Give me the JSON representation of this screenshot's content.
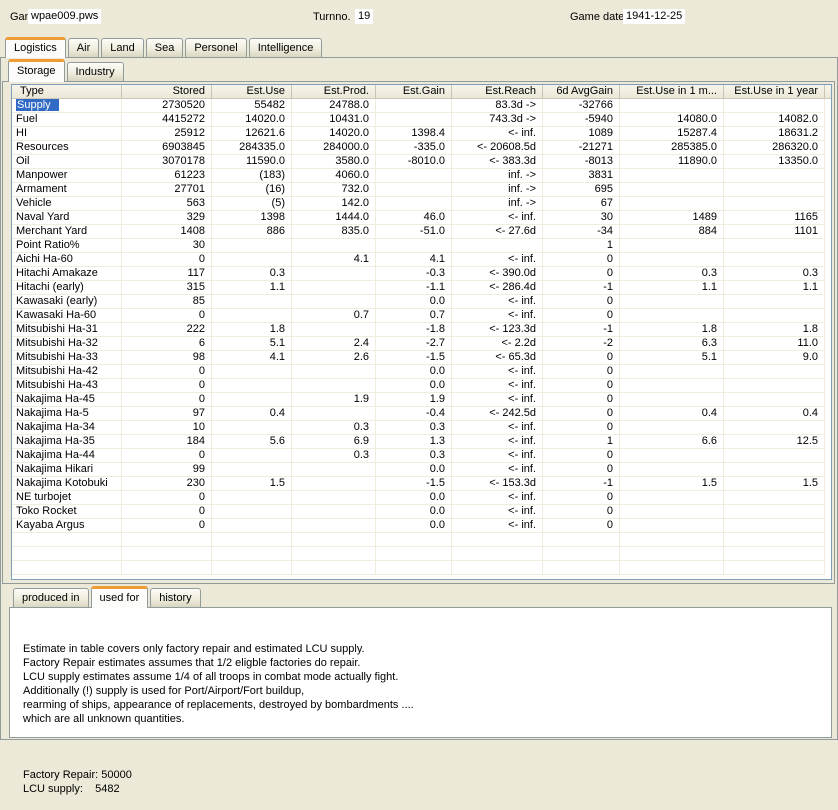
{
  "colors": {
    "window_bg": "#ece9d8",
    "panel_border": "#919b9c",
    "table_border": "#7f9db9",
    "tab_accent": "#ee9c33",
    "selection_blue": "#316ac5"
  },
  "topbar": {
    "game_label": "Game",
    "game_value": "wpae009.pws",
    "turn_label": "Turnno.",
    "turn_value": "19",
    "date_label": "Game date",
    "date_value": "1941-12-25"
  },
  "main_tabs": {
    "items": [
      {
        "label": "Logistics",
        "active": true
      },
      {
        "label": "Air",
        "active": false
      },
      {
        "label": "Land",
        "active": false
      },
      {
        "label": "Sea",
        "active": false
      },
      {
        "label": "Personel",
        "active": false
      },
      {
        "label": "Intelligence",
        "active": false
      }
    ]
  },
  "sub_tabs": {
    "items": [
      {
        "label": "Storage",
        "active": true
      },
      {
        "label": "Industry",
        "active": false
      }
    ]
  },
  "table": {
    "columns": [
      "Type",
      "Stored",
      "Est.Use",
      "Est.Prod.",
      "Est.Gain",
      "Est.Reach",
      "6d AvgGain",
      "Est.Use in 1 m...",
      "Est.Use in 1 year"
    ],
    "selected_cell": {
      "row": 0,
      "col": 0
    },
    "empty_rows": 3,
    "rows": [
      [
        "Supply",
        "2730520",
        "55482",
        "24788.0",
        "",
        "83.3d ->",
        "-32766",
        "",
        ""
      ],
      [
        "Fuel",
        "4415272",
        "14020.0",
        "10431.0",
        "",
        "743.3d ->",
        "-5940",
        "14080.0",
        "14082.0"
      ],
      [
        "HI",
        "25912",
        "12621.6",
        "14020.0",
        "1398.4",
        "<- inf.",
        "1089",
        "15287.4",
        "18631.2"
      ],
      [
        "Resources",
        "6903845",
        "284335.0",
        "284000.0",
        "-335.0",
        "<- 20608.5d",
        "-21271",
        "285385.0",
        "286320.0"
      ],
      [
        "Oil",
        "3070178",
        "11590.0",
        "3580.0",
        "-8010.0",
        "<- 383.3d",
        "-8013",
        "11890.0",
        "13350.0"
      ],
      [
        "Manpower",
        "61223",
        "(183)",
        "4060.0",
        "",
        "inf. ->",
        "3831",
        "",
        ""
      ],
      [
        "Armament",
        "27701",
        "(16)",
        "732.0",
        "",
        "inf. ->",
        "695",
        "",
        ""
      ],
      [
        "Vehicle",
        "563",
        "(5)",
        "142.0",
        "",
        "inf. ->",
        "67",
        "",
        ""
      ],
      [
        "Naval Yard",
        "329",
        "1398",
        "1444.0",
        "46.0",
        "<- inf.",
        "30",
        "1489",
        "1165"
      ],
      [
        "Merchant Yard",
        "1408",
        "886",
        "835.0",
        "-51.0",
        "<- 27.6d",
        "-34",
        "884",
        "1101"
      ],
      [
        "Point Ratio%",
        "30",
        "",
        "",
        "",
        "",
        "1",
        "",
        ""
      ],
      [
        "Aichi Ha-60",
        "0",
        "",
        "4.1",
        "4.1",
        "<- inf.",
        "0",
        "",
        ""
      ],
      [
        "Hitachi Amakaze",
        "117",
        "0.3",
        "",
        "-0.3",
        "<- 390.0d",
        "0",
        "0.3",
        "0.3"
      ],
      [
        "Hitachi (early)",
        "315",
        "1.1",
        "",
        "-1.1",
        "<- 286.4d",
        "-1",
        "1.1",
        "1.1"
      ],
      [
        "Kawasaki (early)",
        "85",
        "",
        "",
        "0.0",
        "<- inf.",
        "0",
        "",
        ""
      ],
      [
        "Kawasaki Ha-60",
        "0",
        "",
        "0.7",
        "0.7",
        "<- inf.",
        "0",
        "",
        ""
      ],
      [
        "Mitsubishi Ha-31",
        "222",
        "1.8",
        "",
        "-1.8",
        "<- 123.3d",
        "-1",
        "1.8",
        "1.8"
      ],
      [
        "Mitsubishi Ha-32",
        "6",
        "5.1",
        "2.4",
        "-2.7",
        "<- 2.2d",
        "-2",
        "6.3",
        "11.0"
      ],
      [
        "Mitsubishi Ha-33",
        "98",
        "4.1",
        "2.6",
        "-1.5",
        "<- 65.3d",
        "0",
        "5.1",
        "9.0"
      ],
      [
        "Mitsubishi Ha-42",
        "0",
        "",
        "",
        "0.0",
        "<- inf.",
        "0",
        "",
        ""
      ],
      [
        "Mitsubishi Ha-43",
        "0",
        "",
        "",
        "0.0",
        "<- inf.",
        "0",
        "",
        ""
      ],
      [
        "Nakajima Ha-45",
        "0",
        "",
        "1.9",
        "1.9",
        "<- inf.",
        "0",
        "",
        ""
      ],
      [
        "Nakajima Ha-5",
        "97",
        "0.4",
        "",
        "-0.4",
        "<- 242.5d",
        "0",
        "0.4",
        "0.4"
      ],
      [
        "Nakajima Ha-34",
        "10",
        "",
        "0.3",
        "0.3",
        "<- inf.",
        "0",
        "",
        ""
      ],
      [
        "Nakajima Ha-35",
        "184",
        "5.6",
        "6.9",
        "1.3",
        "<- inf.",
        "1",
        "6.6",
        "12.5"
      ],
      [
        "Nakajima Ha-44",
        "0",
        "",
        "0.3",
        "0.3",
        "<- inf.",
        "0",
        "",
        ""
      ],
      [
        "Nakajima Hikari",
        "99",
        "",
        "",
        "0.0",
        "<- inf.",
        "0",
        "",
        ""
      ],
      [
        "Nakajima Kotobuki",
        "230",
        "1.5",
        "",
        "-1.5",
        "<- 153.3d",
        "-1",
        "1.5",
        "1.5"
      ],
      [
        "NE turbojet",
        "0",
        "",
        "",
        "0.0",
        "<- inf.",
        "0",
        "",
        ""
      ],
      [
        "Toko Rocket",
        "0",
        "",
        "",
        "0.0",
        "<- inf.",
        "0",
        "",
        ""
      ],
      [
        "Kayaba Argus",
        "0",
        "",
        "",
        "0.0",
        "<- inf.",
        "0",
        "",
        ""
      ]
    ]
  },
  "bottom_tabs": {
    "items": [
      {
        "label": "produced in",
        "active": false
      },
      {
        "label": "used for",
        "active": true
      },
      {
        "label": "history",
        "active": false
      }
    ]
  },
  "info_panel": {
    "lines": [
      "Estimate in table covers only factory repair and estimated LCU supply.",
      "Factory Repair estimates assumes that 1/2 eligble factories do repair.",
      "LCU supply estimates assume 1/4 of all troops in combat mode actually fight.",
      "Additionally (!) supply is used for Port/Airport/Fort buildup,",
      "rearming of ships, appearance of replacements, destroyed by bombardments ....",
      "which are all unknown quantities."
    ],
    "stats": [
      "Factory Repair: 50000",
      "LCU supply:    5482"
    ]
  }
}
